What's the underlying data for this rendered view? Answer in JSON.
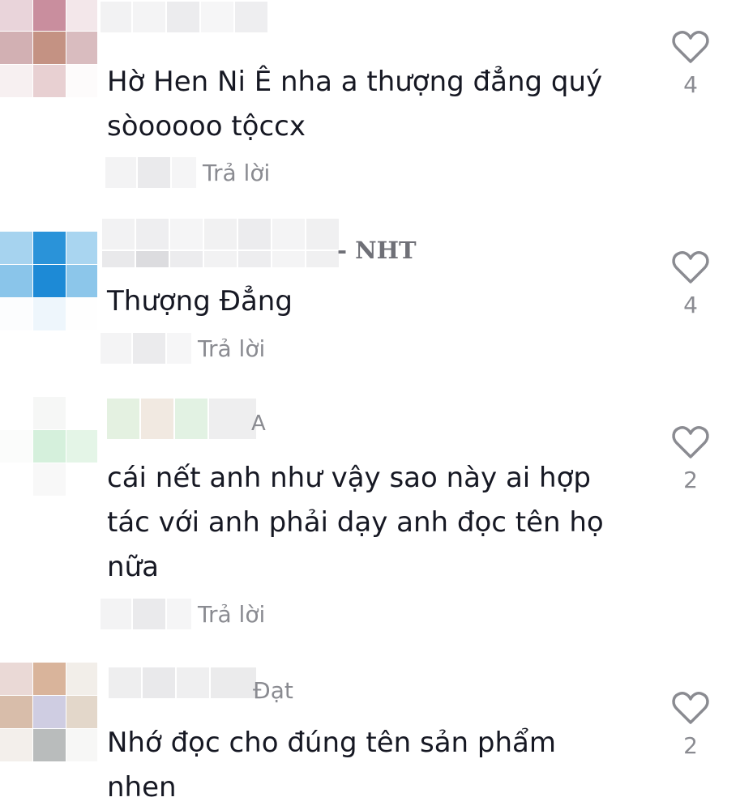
{
  "reply_label": "Trả lời",
  "comments": [
    {
      "text_lines": [
        "Hờ Hen Ni Ê nha a thượng đẳng quý",
        "sòooooo tộccx"
      ],
      "author_suffix": "",
      "likes": "4"
    },
    {
      "text_lines": [
        "Thượng Đẳng"
      ],
      "author_suffix": "- NHT",
      "likes": "4"
    },
    {
      "text_lines": [
        "cái nết anh như vậy sao này ai hợp",
        "tác với anh phải dạy anh đọc tên họ",
        "nữa"
      ],
      "author_suffix": "A",
      "likes": "2"
    },
    {
      "text_lines": [
        "Nhớ đọc cho đúng tên sản phẩm",
        "nhen"
      ],
      "author_suffix": "Đạt",
      "likes": "2"
    }
  ],
  "icons": {
    "like": "heart-outline-icon"
  },
  "colors": {
    "text": "#161823",
    "muted": "#8a8b91"
  }
}
